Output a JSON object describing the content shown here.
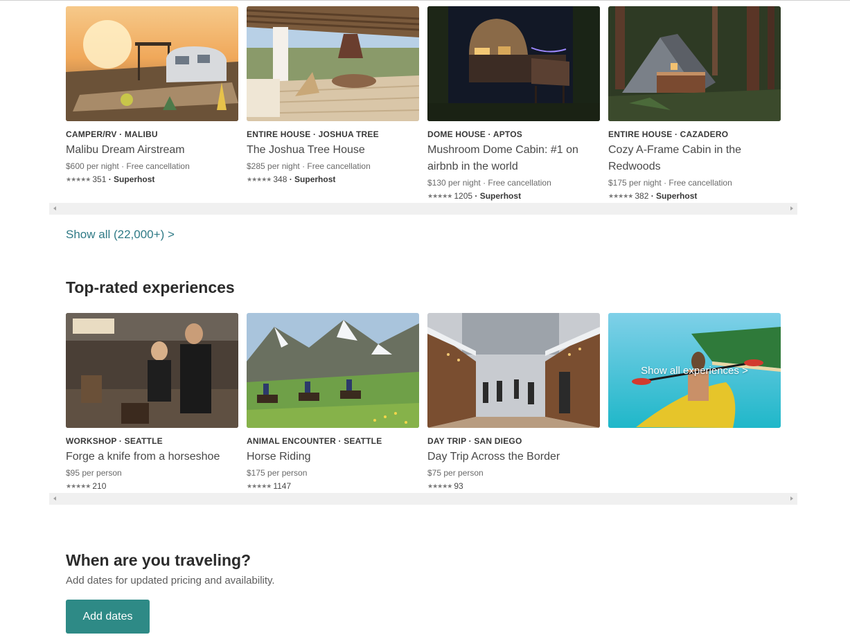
{
  "homes": [
    {
      "kicker": "CAMPER/RV · MALIBU",
      "title": "Malibu Dream Airstream",
      "price": "$600 per night · Free cancellation",
      "stars": "★★★★★",
      "reviews": "351",
      "badge": "· Superhost"
    },
    {
      "kicker": "ENTIRE HOUSE · JOSHUA TREE",
      "title": "The Joshua Tree House",
      "price": "$285 per night · Free cancellation",
      "stars": "★★★★★",
      "reviews": "348",
      "badge": "· Superhost"
    },
    {
      "kicker": "DOME HOUSE · APTOS",
      "title": "Mushroom Dome Cabin: #1 on airbnb in the world",
      "price": "$130 per night · Free cancellation",
      "stars": "★★★★★",
      "reviews": "1205",
      "badge": "· Superhost"
    },
    {
      "kicker": "ENTIRE HOUSE · CAZADERO",
      "title": "Cozy A-Frame Cabin in the Redwoods",
      "price": "$175 per night · Free cancellation",
      "stars": "★★★★★",
      "reviews": "382",
      "badge": "· Superhost"
    }
  ],
  "homes_show_all": "Show all (22,000+) >",
  "experiences_heading": "Top-rated experiences",
  "experiences": [
    {
      "kicker": "WORKSHOP · SEATTLE",
      "title": "Forge a knife from a horseshoe",
      "price": "$95 per person",
      "stars": "★★★★★",
      "reviews": "210"
    },
    {
      "kicker": "ANIMAL ENCOUNTER · SEATTLE",
      "title": "Horse Riding",
      "price": "$175 per person",
      "stars": "★★★★★",
      "reviews": "1147"
    },
    {
      "kicker": "DAY TRIP · SAN DIEGO",
      "title": "Day Trip Across the Border",
      "price": "$75 per person",
      "stars": "★★★★★",
      "reviews": "93"
    }
  ],
  "experiences_show_all": "Show all experiences >",
  "traveling": {
    "heading": "When are you traveling?",
    "subtext": "Add dates for updated pricing and availability.",
    "button": "Add dates"
  },
  "colors": {
    "link": "#2f7a86",
    "button": "#2e8a86"
  }
}
